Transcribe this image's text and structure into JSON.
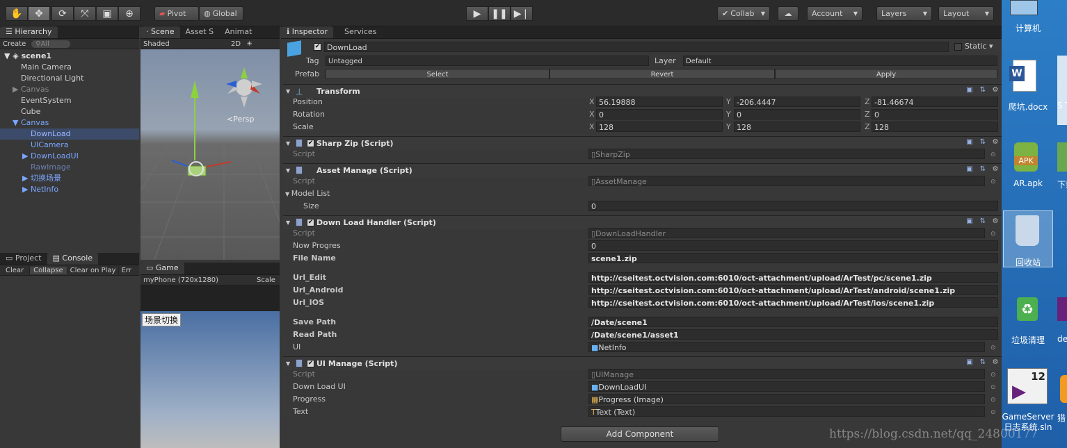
{
  "toolbar": {
    "pivot": "Pivot",
    "global": "Global",
    "collab": "Collab",
    "account": "Account",
    "layers": "Layers",
    "layout": "Layout"
  },
  "hierarchy": {
    "tab": "Hierarchy",
    "create": "Create",
    "search": "All",
    "scene": "scene1",
    "items": [
      "Main Camera",
      "Directional Light",
      "Canvas",
      "EventSystem",
      "Cube",
      "Canvas",
      "DownLoad",
      "UICamera",
      "DownLoadUI",
      "RawImage",
      "切换场景",
      "NetInfo"
    ]
  },
  "scene": {
    "tabs": [
      "Scene",
      "Asset S",
      "Animat"
    ],
    "shaded": "Shaded",
    "mode2d": "2D",
    "persp": "Persp"
  },
  "game": {
    "tab": "Game",
    "device": "myPhone (720x1280)",
    "scale": "Scale",
    "button": "场景切换"
  },
  "console": {
    "tabs": [
      "Project",
      "Console"
    ],
    "buttons": [
      "Clear",
      "Collapse",
      "Clear on Play",
      "Err"
    ]
  },
  "inspector": {
    "tabs": [
      "Inspector",
      "Services"
    ],
    "name": "DownLoad",
    "static": "Static",
    "tag_label": "Tag",
    "tag": "Untagged",
    "layer_label": "Layer",
    "layer": "Default",
    "prefab_label": "Prefab",
    "select": "Select",
    "revert": "Revert",
    "apply": "Apply",
    "transform": {
      "title": "Transform",
      "position": "Position",
      "rotation": "Rotation",
      "scale": "Scale",
      "px": "56.19888",
      "py": "-206.4447",
      "pz": "-81.46674",
      "rx": "0",
      "ry": "0",
      "rz": "0",
      "sx": "128",
      "sy": "128",
      "sz": "128",
      "xl": "X",
      "yl": "Y",
      "zl": "Z"
    },
    "sharpzip": {
      "title": "Sharp Zip (Script)",
      "script_label": "Script",
      "script": "SharpZip"
    },
    "assetmanage": {
      "title": "Asset Manage (Script)",
      "script_label": "Script",
      "script": "AssetManage",
      "model_list": "Model List",
      "size_label": "Size",
      "size": "0"
    },
    "downloadhandler": {
      "title": "Down Load Handler (Script)",
      "script_label": "Script",
      "script": "DownLoadHandler",
      "now_progres_label": "Now Progres",
      "now_progres": "0",
      "file_name_label": "File Name",
      "file_name": "scene1.zip",
      "url_edit_label": "Url_Edit",
      "url_edit": "http://cseitest.octvision.com:6010/oct-attachment/upload/ArTest/pc/scene1.zip",
      "url_android_label": "Url_Android",
      "url_android": "http://cseitest.octvision.com:6010/oct-attachment/upload/ArTest/android/scene1.zip",
      "url_ios_label": "Url_IOS",
      "url_ios": "http://cseitest.octvision.com:6010/oct-attachment/upload/ArTest/ios/scene1.zip",
      "save_path_label": "Save Path",
      "save_path": "/Date/scene1",
      "read_path_label": "Read Path",
      "read_path": "/Date/scene1/asset1",
      "ui_label": "UI",
      "ui": "NetInfo"
    },
    "uimanage": {
      "title": "UI Manage (Script)",
      "script_label": "Script",
      "script": "UIManage",
      "download_ui_label": "Down Load UI",
      "download_ui": "DownLoadUI",
      "progress_label": "Progress",
      "progress": "Progress (Image)",
      "text_label": "Text",
      "text": "Text (Text)"
    },
    "add_component": "Add Component"
  },
  "desktop": {
    "items": [
      "计算机",
      "爬坑.docx",
      "AR.apk",
      "回收站",
      "垃圾清理",
      "GameServer日志系统.sln",
      "下载",
      "S To",
      "de",
      "猎"
    ],
    "apk_badge": "APK",
    "vs_badge": "12"
  },
  "watermark": "https://blog.csdn.net/qq_24800177",
  "colors": {
    "accent": "#3d5f8a",
    "desktop": "#2a78c2"
  }
}
